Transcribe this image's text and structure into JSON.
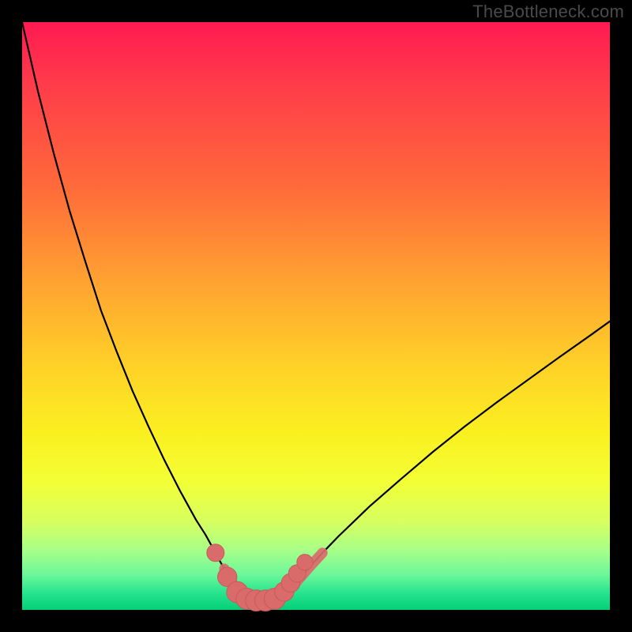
{
  "watermark": "TheBottleneck.com",
  "colors": {
    "curve": "#000000",
    "marker_fill": "#d96b6b",
    "marker_stroke": "#c85a5a",
    "gradient_top": "#ff1a52",
    "gradient_bottom": "#05cf78",
    "frame": "#000000"
  },
  "chart_data": {
    "type": "line",
    "title": "",
    "xlabel": "",
    "ylabel": "",
    "xlim": [
      0,
      100
    ],
    "ylim": [
      0,
      100
    ],
    "grid": false,
    "legend": false,
    "series": [
      {
        "name": "left-curve",
        "x": [
          0.0,
          2.7,
          5.4,
          8.1,
          10.8,
          13.4,
          16.1,
          18.8,
          21.5,
          24.2,
          26.9,
          29.6,
          31.2,
          32.3,
          33.3,
          34.4,
          35.5,
          36.6,
          36.8
        ],
        "values": [
          100.0,
          88.2,
          77.6,
          67.8,
          59.1,
          51.0,
          43.9,
          37.2,
          31.2,
          25.5,
          20.2,
          15.3,
          12.8,
          10.8,
          8.9,
          7.0,
          5.1,
          3.0,
          2.4
        ]
      },
      {
        "name": "right-curve",
        "x": [
          44.4,
          45.4,
          47.0,
          48.9,
          51.1,
          53.8,
          56.5,
          59.1,
          64.5,
          69.9,
          75.3,
          80.6,
          86.0,
          91.4,
          96.8,
          100.0
        ],
        "values": [
          2.4,
          3.2,
          5.1,
          7.3,
          9.7,
          12.5,
          15.1,
          17.6,
          22.3,
          26.9,
          31.2,
          35.2,
          39.1,
          43.0,
          46.8,
          49.1
        ]
      },
      {
        "name": "bottom-flat",
        "x": [
          36.8,
          38.2,
          39.8,
          41.4,
          43.0,
          44.4
        ],
        "values": [
          2.4,
          1.6,
          1.3,
          1.3,
          1.6,
          2.4
        ]
      }
    ],
    "markers": [
      {
        "x": 32.9,
        "y": 9.7,
        "r": 1.7
      },
      {
        "x": 34.9,
        "y": 5.6,
        "r": 2.0
      },
      {
        "x": 36.6,
        "y": 3.0,
        "r": 2.3
      },
      {
        "x": 38.2,
        "y": 1.9,
        "r": 2.3
      },
      {
        "x": 39.8,
        "y": 1.6,
        "r": 2.3
      },
      {
        "x": 41.4,
        "y": 1.6,
        "r": 2.3
      },
      {
        "x": 43.0,
        "y": 1.9,
        "r": 2.3
      },
      {
        "x": 44.6,
        "y": 3.1,
        "r": 2.0
      },
      {
        "x": 45.7,
        "y": 4.6,
        "r": 1.9
      },
      {
        "x": 46.8,
        "y": 6.2,
        "r": 1.7
      },
      {
        "x": 48.1,
        "y": 8.1,
        "r": 1.5
      }
    ]
  }
}
